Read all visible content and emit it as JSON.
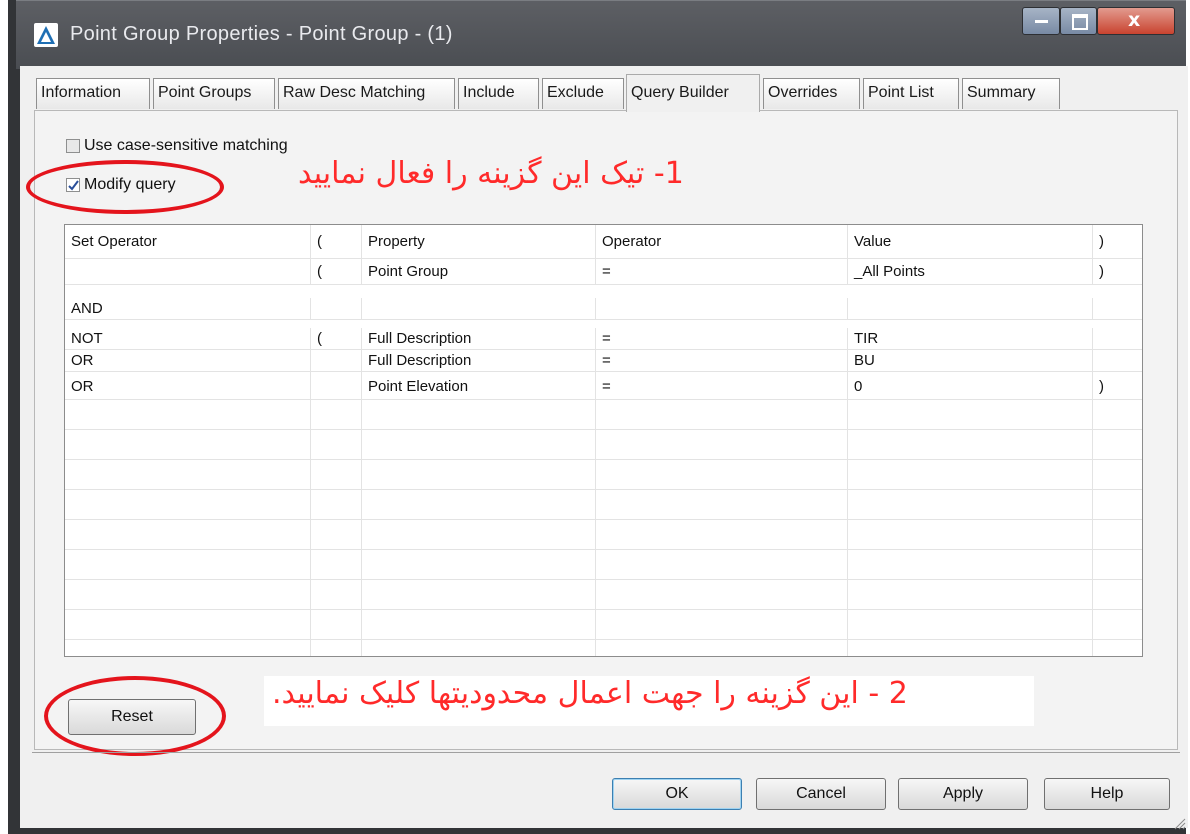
{
  "window": {
    "title": "Point Group Properties - Point Group - (1)"
  },
  "tabs": [
    "Information",
    "Point Groups",
    "Raw Desc Matching",
    "Include",
    "Exclude",
    "Query Builder",
    "Overrides",
    "Point List",
    "Summary"
  ],
  "active_tab": "Query Builder",
  "options": {
    "case_sensitive_label": "Use case-sensitive matching",
    "case_sensitive_checked": false,
    "modify_query_label": "Modify query",
    "modify_query_checked": true
  },
  "annotations": {
    "step1": "1- تیک این گزینه را فعال نمایید",
    "step2": "2 - این گزینه را جهت اعمال محدودیتها کلیک نمایید."
  },
  "grid": {
    "columns": [
      "Set Operator",
      "(",
      "Property",
      "Operator",
      "Value",
      ")"
    ],
    "rows": [
      [
        "",
        "(",
        "Point Group",
        "=",
        "_All Points",
        ")"
      ],
      [
        "AND",
        "",
        "",
        "",
        "",
        ""
      ],
      [
        "NOT",
        "(",
        "Full Description",
        "=",
        "TIR",
        ""
      ],
      [
        "OR",
        "",
        "Full Description",
        "=",
        "BU",
        ""
      ],
      [
        "OR",
        "",
        "Point Elevation",
        "=",
        "0",
        ")"
      ]
    ]
  },
  "buttons": {
    "reset": "Reset",
    "ok": "OK",
    "cancel": "Cancel",
    "apply": "Apply",
    "help": "Help"
  }
}
